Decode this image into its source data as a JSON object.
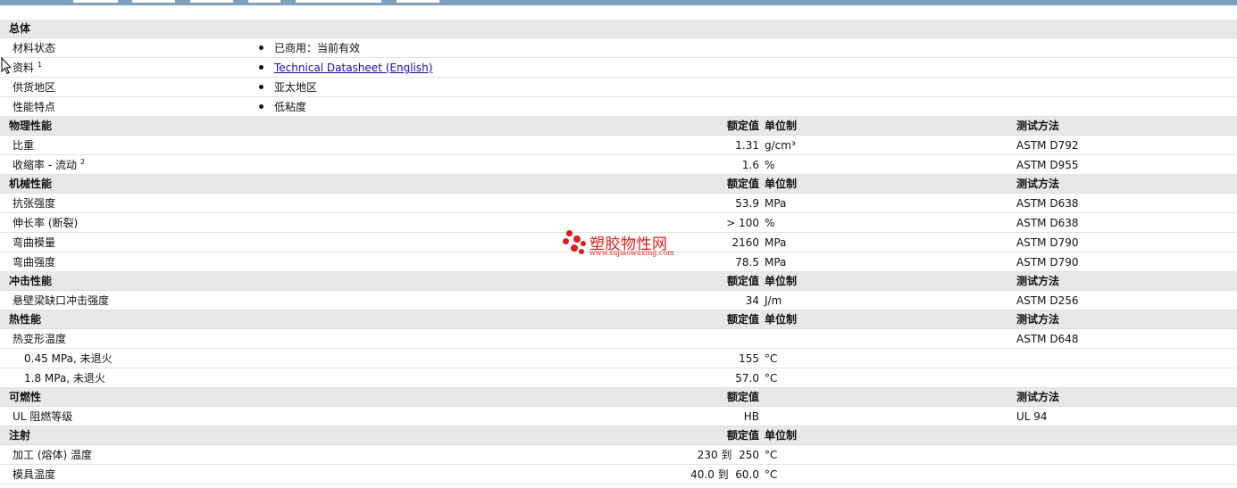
{
  "general": {
    "header": "总体",
    "rows": [
      {
        "name": "材料状态",
        "value": "已商用：当前有效",
        "sup": ""
      },
      {
        "name": "资料",
        "value": "Technical Datasheet (English)",
        "sup": "1"
      },
      {
        "name": "供货地区",
        "value": "亚太地区",
        "sup": ""
      },
      {
        "name": "性能特点",
        "value": "低粘度",
        "sup": ""
      }
    ]
  },
  "physical": {
    "header": "物理性能",
    "col_value": "额定值",
    "col_unit": "单位制",
    "col_method": "测试方法",
    "rows": [
      {
        "name": "比重",
        "sup": "",
        "value": "1.31",
        "unit": "g/cm³",
        "method": "ASTM D792"
      },
      {
        "name": "收缩率 - 流动",
        "sup": "2",
        "value": "1.6",
        "unit": "%",
        "method": "ASTM D955"
      }
    ]
  },
  "mechanical": {
    "header": "机械性能",
    "col_value": "额定值",
    "col_unit": "单位制",
    "col_method": "测试方法",
    "rows": [
      {
        "name": "抗张强度",
        "value": "53.9",
        "unit": "MPa",
        "method": "ASTM D638"
      },
      {
        "name": "伸长率 (断裂)",
        "value": "> 100",
        "unit": "%",
        "method": "ASTM D638"
      },
      {
        "name": "弯曲模量",
        "value": "2160",
        "unit": "MPa",
        "method": "ASTM D790"
      },
      {
        "name": "弯曲强度",
        "value": "78.5",
        "unit": "MPa",
        "method": "ASTM D790"
      }
    ]
  },
  "impact": {
    "header": "冲击性能",
    "col_value": "额定值",
    "col_unit": "单位制",
    "col_method": "测试方法",
    "rows": [
      {
        "name": "悬壁梁缺口冲击强度",
        "value": "34",
        "unit": "J/m",
        "method": "ASTM D256"
      }
    ]
  },
  "thermal": {
    "header": "热性能",
    "col_value": "额定值",
    "col_unit": "单位制",
    "col_method": "测试方法",
    "rows": [
      {
        "name": "热变形温度",
        "value": "",
        "unit": "",
        "method": "ASTM D648"
      },
      {
        "name": "0.45 MPa, 未退火",
        "value": "155",
        "unit": "°C",
        "method": ""
      },
      {
        "name": "1.8 MPa, 未退火",
        "value": "57.0",
        "unit": "°C",
        "method": ""
      }
    ]
  },
  "flammability": {
    "header": "可燃性",
    "col_value": "额定值",
    "col_method": "测试方法",
    "rows": [
      {
        "name": "UL 阻燃等级",
        "value": "HB",
        "method": "UL 94"
      }
    ]
  },
  "injection": {
    "header": "注射",
    "col_value": "额定值",
    "col_unit": "单位制",
    "rows": [
      {
        "name": "加工 (熔体) 温度",
        "value": "230 到  250",
        "unit": "°C"
      },
      {
        "name": "模具温度",
        "value": "40.0 到  60.0",
        "unit": "°C"
      }
    ]
  },
  "watermark": {
    "title": "塑胶物性网",
    "url": "www.sujiaowuxing.com",
    "color": "#e01d1d"
  }
}
